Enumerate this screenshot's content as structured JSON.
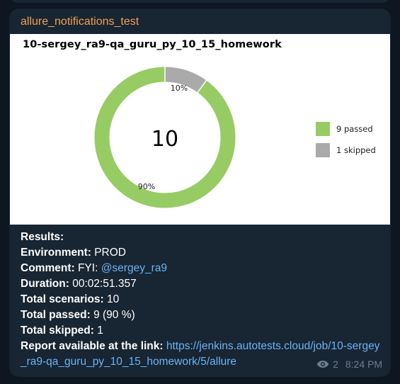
{
  "message": {
    "sender": "allure_notifications_test",
    "views": "2",
    "time": "8:24 PM"
  },
  "chart_data": {
    "type": "pie",
    "title": "10-sergey_ra9-qa_guru_py_10_15_homework",
    "center_label": "10",
    "slices": [
      {
        "name": "passed",
        "value": 9,
        "percent_label": "90%",
        "color": "#97cc64"
      },
      {
        "name": "skipped",
        "value": 1,
        "percent_label": "10%",
        "color": "#aaaaaa"
      }
    ],
    "legend": [
      {
        "label": "9 passed",
        "color": "#97cc64"
      },
      {
        "label": "1 skipped",
        "color": "#aaaaaa"
      }
    ],
    "legend_position": "right"
  },
  "results": {
    "heading": "Results:",
    "environment_label": "Environment:",
    "environment_value": "PROD",
    "comment_label": "Comment:",
    "comment_prefix": "FYI:",
    "comment_mention": "@sergey_ra9",
    "duration_label": "Duration:",
    "duration_value": "00:02:51.357",
    "total_scenarios_label": "Total scenarios:",
    "total_scenarios_value": "10",
    "total_passed_label": "Total passed:",
    "total_passed_value": "9 (90 %)",
    "total_skipped_label": "Total skipped:",
    "total_skipped_value": "1",
    "report_label": "Report available at the link:",
    "report_url": "https://jenkins.autotests.cloud/job/10-sergey_ra9-qa_guru_py_10_15_homework/5/allure"
  },
  "colors": {
    "background": "#0e1621",
    "bubble": "#182533",
    "sender": "#f3a14e",
    "link": "#6ab3f3",
    "meta": "#6d7f8f"
  },
  "icons": {
    "views": "eye-icon"
  }
}
